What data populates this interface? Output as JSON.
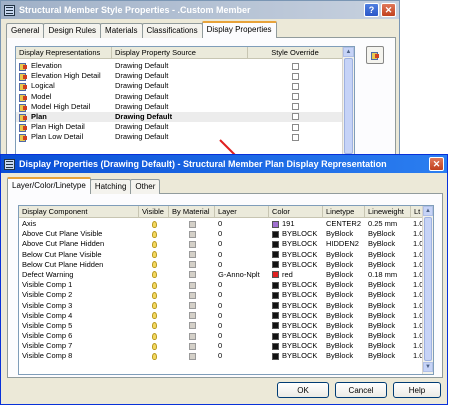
{
  "back_window": {
    "title": "Structural Member Style Properties - .Custom Member",
    "tabs": [
      "General",
      "Design Rules",
      "Materials",
      "Classifications",
      "Display Properties"
    ],
    "active_tab": 4,
    "columns": [
      "Display Representations",
      "Display Property Source",
      "Style Override"
    ],
    "rows": [
      {
        "name": "Elevation",
        "source": "Drawing Default"
      },
      {
        "name": "Elevation High Detail",
        "source": "Drawing Default"
      },
      {
        "name": "Logical",
        "source": "Drawing Default"
      },
      {
        "name": "Model",
        "source": "Drawing Default"
      },
      {
        "name": "Model High Detail",
        "source": "Drawing Default"
      },
      {
        "name": "Plan",
        "source": "Drawing Default",
        "selected": true
      },
      {
        "name": "Plan High Detail",
        "source": "Drawing Default"
      },
      {
        "name": "Plan Low Detail",
        "source": "Drawing Default"
      }
    ],
    "colors": {
      "title_gradient_start": "#9fb0c7",
      "title_gradient_end": "#c7d1df"
    }
  },
  "front_window": {
    "title": "Display Properties (Drawing Default) - Structural Member Plan Display Representation",
    "tabs": [
      "Layer/Color/Linetype",
      "Hatching",
      "Other"
    ],
    "active_tab": 0,
    "columns": [
      "Display Component",
      "Visible",
      "By Material",
      "Layer",
      "Color",
      "Linetype",
      "Lineweight",
      "Lt"
    ],
    "rows": [
      {
        "component": "Axis",
        "layer": "0",
        "color": "191",
        "swatch": "#a070d0",
        "linetype": "CENTER2",
        "lineweight": "0.25 mm",
        "lt": "1.00"
      },
      {
        "component": "Above Cut Plane Visible",
        "layer": "0",
        "color": "BYBLOCK",
        "swatch": "#111111",
        "linetype": "ByBlock",
        "lineweight": "ByBlock",
        "lt": "1.00"
      },
      {
        "component": "Above Cut Plane Hidden",
        "layer": "0",
        "color": "BYBLOCK",
        "swatch": "#111111",
        "linetype": "HIDDEN2",
        "lineweight": "ByBlock",
        "lt": "1.00"
      },
      {
        "component": "Below Cut Plane Visible",
        "layer": "0",
        "color": "BYBLOCK",
        "swatch": "#111111",
        "linetype": "ByBlock",
        "lineweight": "ByBlock",
        "lt": "1.00"
      },
      {
        "component": "Below Cut Plane Hidden",
        "layer": "0",
        "color": "BYBLOCK",
        "swatch": "#111111",
        "linetype": "ByBlock",
        "lineweight": "ByBlock",
        "lt": "1.00"
      },
      {
        "component": "Defect Warning",
        "layer": "G-Anno-Nplt",
        "color": "red",
        "swatch": "#e02020",
        "linetype": "ByBlock",
        "lineweight": "0.18 mm",
        "lt": "1.00"
      },
      {
        "component": "Visible Comp 1",
        "layer": "0",
        "color": "BYBLOCK",
        "swatch": "#111111",
        "linetype": "ByBlock",
        "lineweight": "ByBlock",
        "lt": "1.00"
      },
      {
        "component": "Visible Comp 2",
        "layer": "0",
        "color": "BYBLOCK",
        "swatch": "#111111",
        "linetype": "ByBlock",
        "lineweight": "ByBlock",
        "lt": "1.00"
      },
      {
        "component": "Visible Comp 3",
        "layer": "0",
        "color": "BYBLOCK",
        "swatch": "#111111",
        "linetype": "ByBlock",
        "lineweight": "ByBlock",
        "lt": "1.00"
      },
      {
        "component": "Visible Comp 4",
        "layer": "0",
        "color": "BYBLOCK",
        "swatch": "#111111",
        "linetype": "ByBlock",
        "lineweight": "ByBlock",
        "lt": "1.00"
      },
      {
        "component": "Visible Comp 5",
        "layer": "0",
        "color": "BYBLOCK",
        "swatch": "#111111",
        "linetype": "ByBlock",
        "lineweight": "ByBlock",
        "lt": "1.00"
      },
      {
        "component": "Visible Comp 6",
        "layer": "0",
        "color": "BYBLOCK",
        "swatch": "#111111",
        "linetype": "ByBlock",
        "lineweight": "ByBlock",
        "lt": "1.00"
      },
      {
        "component": "Visible Comp 7",
        "layer": "0",
        "color": "BYBLOCK",
        "swatch": "#111111",
        "linetype": "ByBlock",
        "lineweight": "ByBlock",
        "lt": "1.00"
      },
      {
        "component": "Visible Comp 8",
        "layer": "0",
        "color": "BYBLOCK",
        "swatch": "#111111",
        "linetype": "ByBlock",
        "lineweight": "ByBlock",
        "lt": "1.00"
      }
    ],
    "buttons": {
      "ok": "OK",
      "cancel": "Cancel",
      "help": "Help"
    },
    "colors": {
      "title_gradient_start": "#0a4fd6",
      "title_gradient_end": "#2b7ef0"
    }
  },
  "icons": {
    "window_icon": "window-icon",
    "help": "?",
    "close": "✕",
    "scroll_up": "▲",
    "scroll_down": "▼"
  },
  "annotation": {
    "arrow_color": "#e02020"
  }
}
